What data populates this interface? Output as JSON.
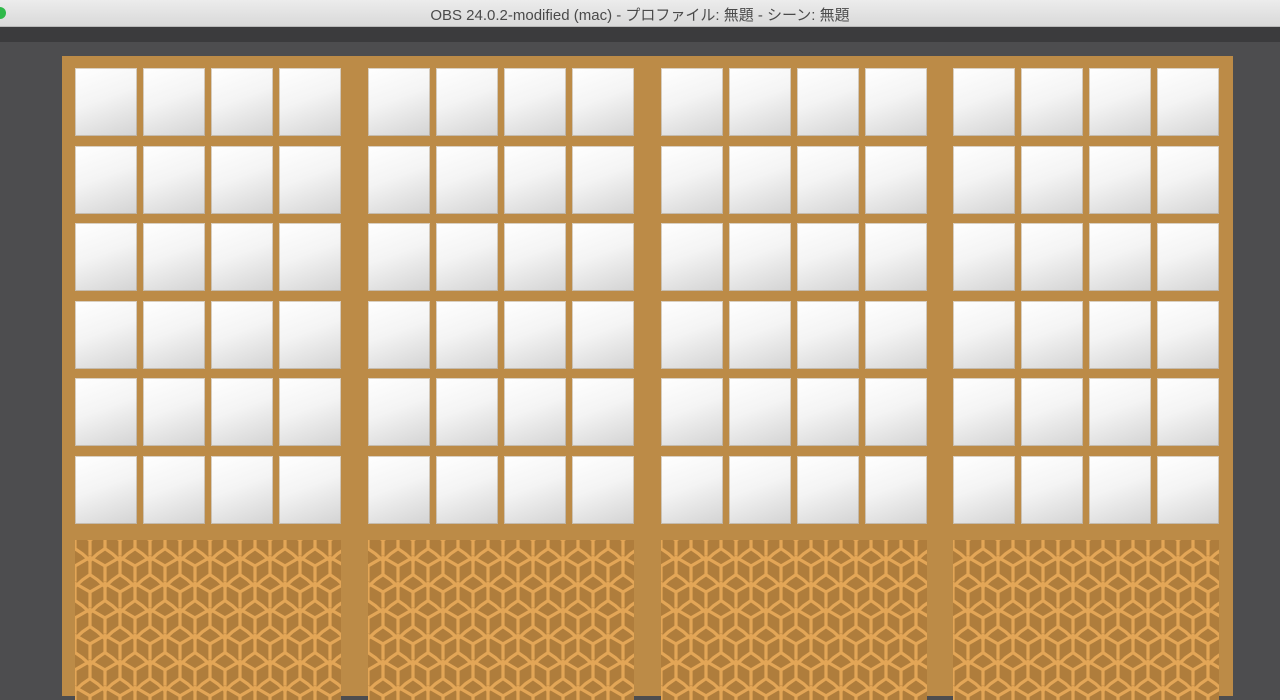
{
  "window": {
    "title": "OBS 24.0.2-modified (mac) - プロファイル: 無題 - シーン: 無題"
  },
  "colors": {
    "frame": "#bc8b47",
    "lattice_bg": "#af7d3c",
    "lattice_line": "#e3a657",
    "background": "#4d4d4f"
  },
  "scene": {
    "panels": 4,
    "rows": 6,
    "columns": 4,
    "pattern": "kikkou-bishamon-lattice"
  }
}
